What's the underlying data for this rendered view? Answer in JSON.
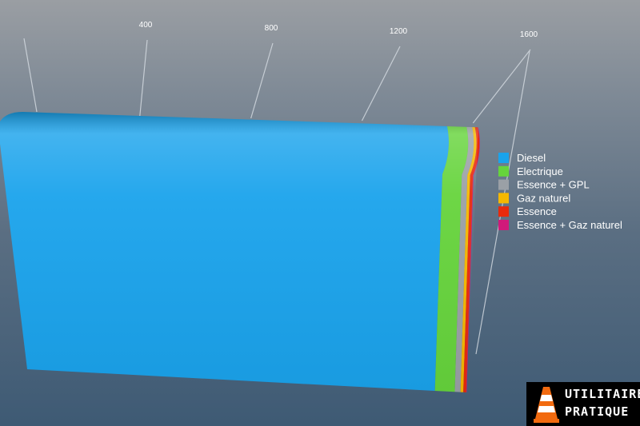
{
  "chart_data": {
    "type": "bar",
    "orientation": "horizontal",
    "stacked": true,
    "style": "3d-perspective",
    "categories": [
      ""
    ],
    "x_ticks": [
      "400",
      "800",
      "1200",
      "1600"
    ],
    "xlim": [
      0,
      1700
    ],
    "series": [
      {
        "name": "Diesel",
        "values": [
          1530
        ],
        "color": "#1aa3ec"
      },
      {
        "name": "Electrique",
        "values": [
          70
        ],
        "color": "#66d43c"
      },
      {
        "name": "Essence + GPL",
        "values": [
          20
        ],
        "color": "#9aa0a6"
      },
      {
        "name": "Gaz naturel",
        "values": [
          10
        ],
        "color": "#f5b800"
      },
      {
        "name": "Essence",
        "values": [
          10
        ],
        "color": "#e82a0c"
      },
      {
        "name": "Essence + Gaz naturel",
        "values": [
          2
        ],
        "color": "#d01a7a"
      }
    ],
    "legend_position": "right"
  },
  "logo": {
    "line1": "UTILITAIRE",
    "line2": "PRATIQUE"
  }
}
